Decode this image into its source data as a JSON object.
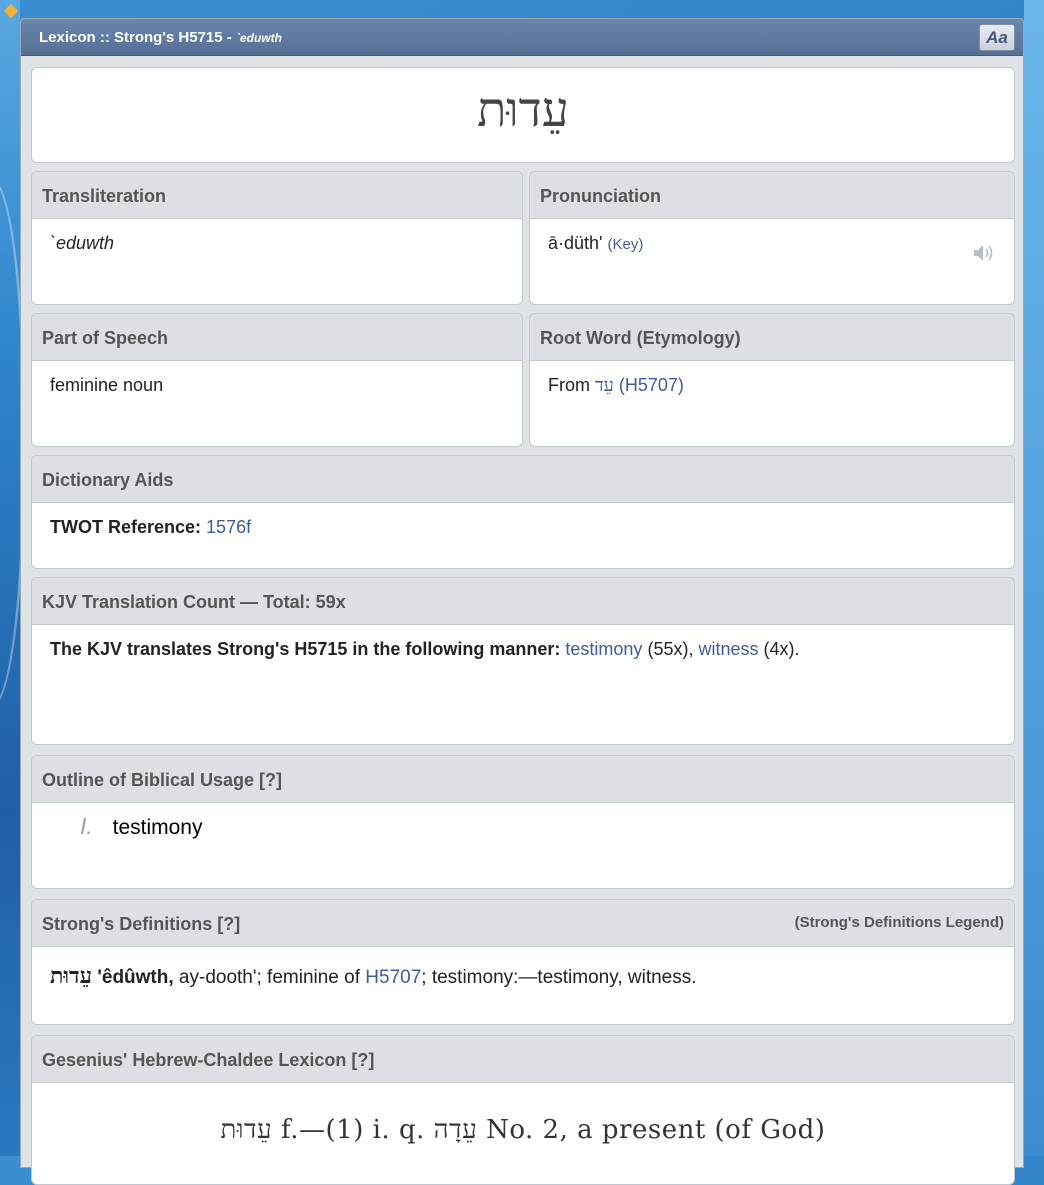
{
  "window": {
    "title": "Lexicon :: Strong's H5715 - ",
    "title_word": "`eduwth",
    "font_button": "Aa"
  },
  "headword": "עֵדוּת",
  "transliteration": {
    "label": "Transliteration",
    "value": "`eduwth"
  },
  "pronunciation": {
    "label": "Pronunciation",
    "value": "ā·düth'",
    "key_link": "(Key)",
    "speaker_icon": "speaker-icon"
  },
  "part_of_speech": {
    "label": "Part of Speech",
    "value": "feminine noun"
  },
  "root_word": {
    "label": "Root Word (Etymology)",
    "prefix": "From",
    "hebrew": "עֵד",
    "ref_link": "(H5707)"
  },
  "dictionary_aids": {
    "label": "Dictionary Aids",
    "twot_label": "TWOT Reference:",
    "twot_link": "1576f"
  },
  "kjv": {
    "label": "KJV Translation Count — Total: 59x",
    "intro": "The KJV translates Strong's H5715 in the following manner:",
    "items": [
      {
        "word": "testimony",
        "count": "(55x),"
      },
      {
        "word": "witness",
        "count": "(4x)."
      }
    ]
  },
  "outline": {
    "label": "Outline of Biblical Usage [?]",
    "items": [
      {
        "num": "I.",
        "text": "testimony"
      }
    ]
  },
  "strongs_def": {
    "label": "Strong's Definitions [?]",
    "legend_link": "(Strong's Definitions Legend)",
    "hebrew": "עֵדוּת",
    "translit": "'êdûwth,",
    "pron": " ay-dooth'; feminine of ",
    "ref_link": "H5707",
    "rest": "; testimony:—testimony, witness."
  },
  "gesenius": {
    "label": "Gesenius' Hebrew-Chaldee Lexicon [?]",
    "line": "עֵדוּת f.—(1) i. q. עֵדָה No. 2, a present (of God)"
  }
}
